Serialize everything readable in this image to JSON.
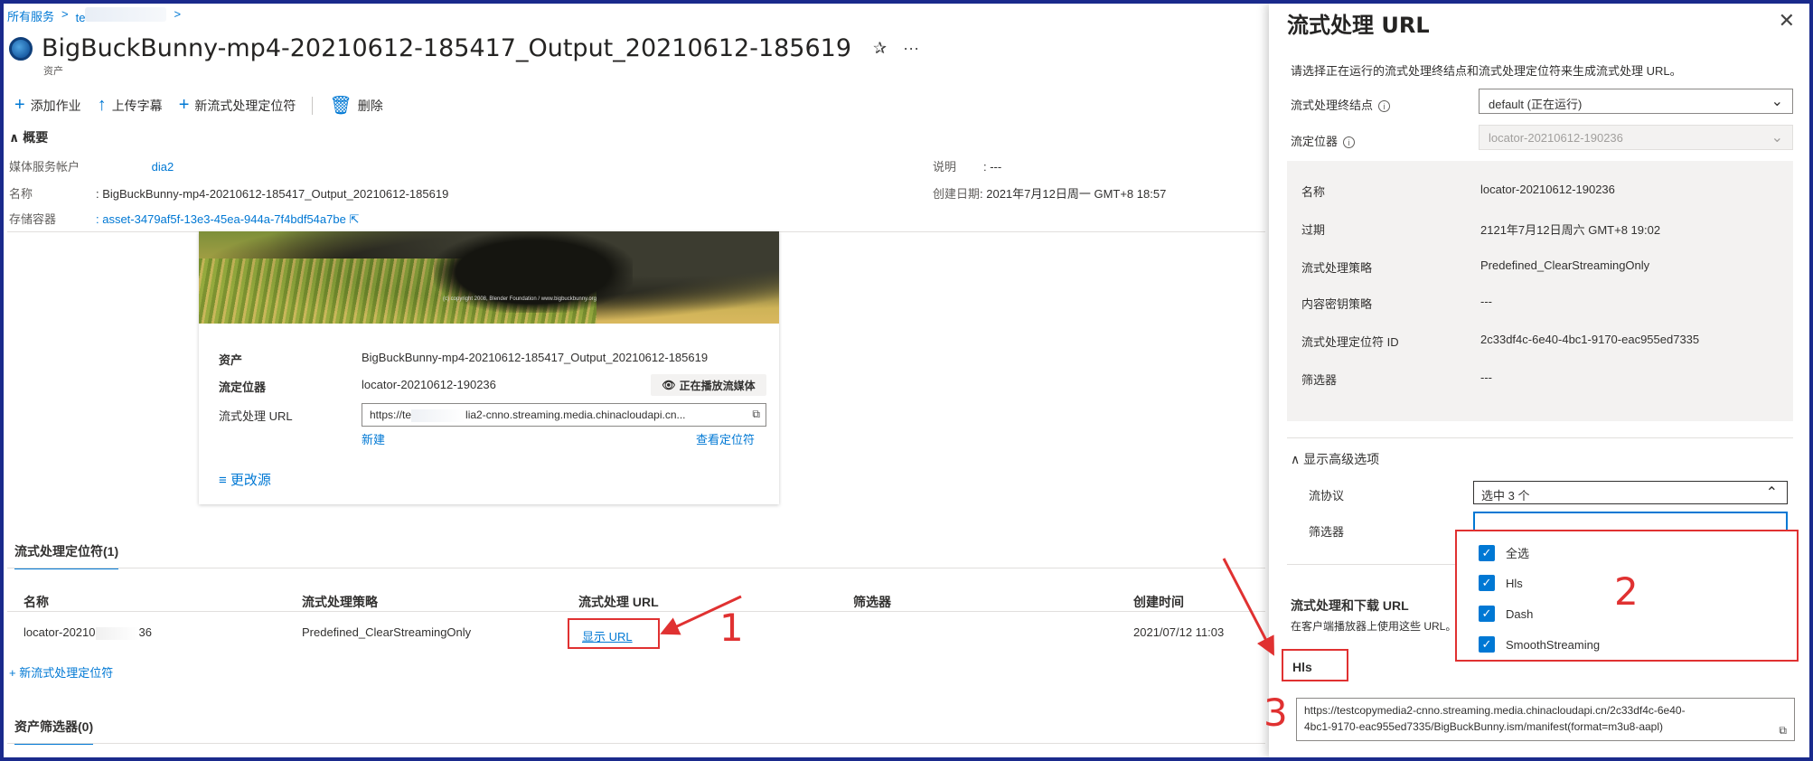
{
  "breadcrumb": {
    "root": "所有服务",
    "sep1": ">",
    "item": "te",
    "sep2": ">"
  },
  "asset": {
    "title": "BigBuckBunny-mp4-20210612-185417_Output_20210612-185619",
    "subtitle": "资产",
    "pin_icon": "✰",
    "more_icon": "···"
  },
  "toolbar": {
    "add_job": "添加作业",
    "upload_subtitle": "上传字幕",
    "new_locator": "新流式处理定位符",
    "delete": "删除"
  },
  "overview": {
    "header": "概要",
    "media_account_label": "媒体服务帐户",
    "media_account_value": "dia2",
    "name_label": "名称",
    "name_value": ": BigBuckBunny-mp4-20210612-185417_Output_20210612-185619",
    "container_label": "存储容器",
    "container_value": ": asset-3479af5f-13e3-45ea-944a-7f4bdf54a7be",
    "desc_label": "说明",
    "desc_value": ": ---",
    "created_label": "创建日期",
    "created_value": ": 2021年7月12日周一 GMT+8 18:57"
  },
  "player": {
    "credit": "(c) copyright 2008, Blender Foundation / www.bigbuckbunny.org",
    "asset_label": "资产",
    "asset_value": "BigBuckBunny-mp4-20210612-185417_Output_20210612-185619",
    "locator_label": "流定位器",
    "locator_value": "locator-20210612-190236",
    "playing_button": "正在播放流媒体",
    "url_label": "流式处理 URL",
    "url_prefix": "https://te",
    "url_suffix": "lia2-cnno.streaming.media.chinacloudapi.cn...",
    "new_link": "新建",
    "view_locator_link": "查看定位符",
    "change_source": "更改源"
  },
  "locators": {
    "tab": "流式处理定位符(1)",
    "columns": [
      "名称",
      "流式处理策略",
      "流式处理 URL",
      "筛选器",
      "创建时间"
    ],
    "row": {
      "name_prefix": "locator-20210",
      "name_suffix": "36",
      "policy": "Predefined_ClearStreamingOnly",
      "url": "显示 URL",
      "created": "2021/07/12 11:03"
    },
    "add_link": "+ 新流式处理定位符"
  },
  "filters_tab": "资产筛选器(0)",
  "panel": {
    "title": "流式处理 URL",
    "close_icon": "✕",
    "description": "请选择正在运行的流式处理终结点和流式处理定位符来生成流式处理 URL。",
    "endpoint_label": "流式处理终结点",
    "endpoint_value": "default (正在运行)",
    "locator_label": "流定位器",
    "locator_value": "locator-20210612-190236",
    "info": [
      {
        "k": "名称",
        "v": "locator-20210612-190236"
      },
      {
        "k": "过期",
        "v": "2121年7月12日周六 GMT+8 19:02"
      },
      {
        "k": "流式处理策略",
        "v": "Predefined_ClearStreamingOnly"
      },
      {
        "k": "内容密钥策略",
        "v": "---"
      },
      {
        "k": "流式处理定位符 ID",
        "v": "2c33df4c-6e40-4bc1-9170-eac955ed7335"
      },
      {
        "k": "筛选器",
        "v": "---"
      }
    ],
    "advanced_toggle": "显示高级选项",
    "protocol_label": "流协议",
    "protocol_value": "选中 3 个",
    "filter_label": "筛选器",
    "options": [
      "全选",
      "Hls",
      "Dash",
      "SmoothStreaming"
    ],
    "download_title": "流式处理和下载 URL",
    "download_sub": "在客户端播放器上使用这些 URL。",
    "hls_label": "Hls",
    "hls_url_line1": "https://testcopymedia2-cnno.streaming.media.chinacloudapi.cn/2c33df4c-6e40-",
    "hls_url_line2": "4bc1-9170-eac955ed7335/BigBuckBunny.ism/manifest(format=m3u8-aapl)"
  },
  "annotations": {
    "n1": "1",
    "n2": "2",
    "n3": "3",
    "color": "#e03131"
  }
}
